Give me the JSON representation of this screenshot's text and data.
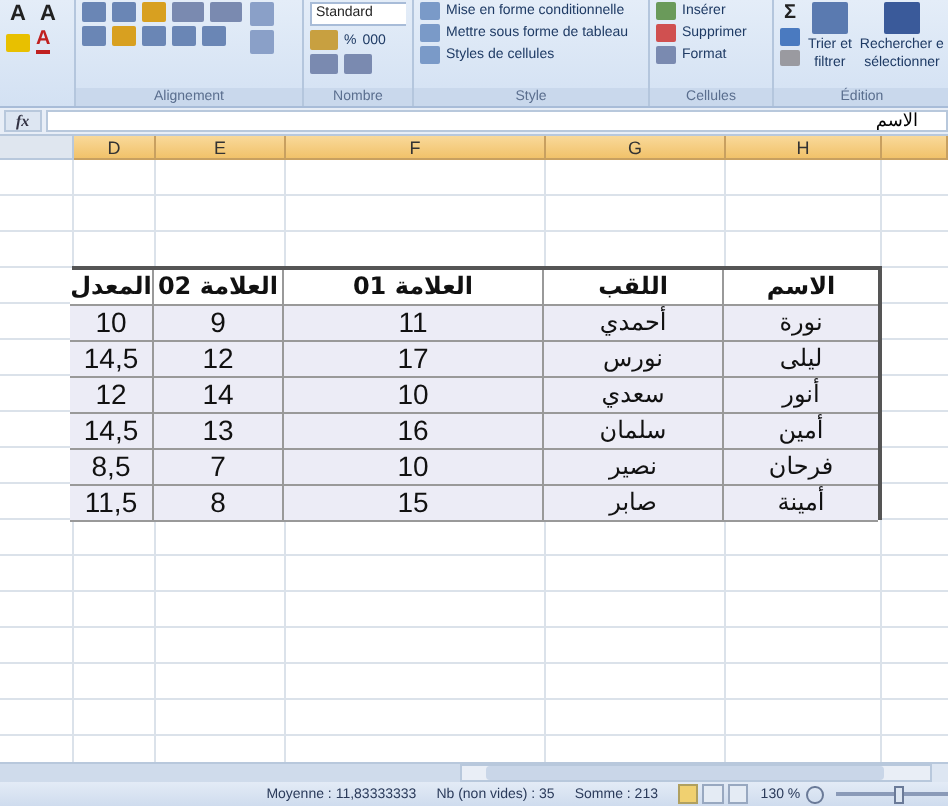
{
  "ribbon": {
    "font": {
      "grow": "A",
      "shrink": "A",
      "font_color_label": "A"
    },
    "alignment": {
      "label": "Alignement"
    },
    "number": {
      "label": "Nombre",
      "format": "Standard",
      "percent": "%",
      "thousands": "000"
    },
    "style": {
      "label": "Style",
      "items": [
        "Mise en forme conditionnelle",
        "Mettre sous forme de tableau",
        "Styles de cellules"
      ]
    },
    "cells": {
      "label": "Cellules",
      "items": [
        "Insérer",
        "Supprimer",
        "Format"
      ]
    },
    "editing": {
      "label": "Édition",
      "sum": "Σ",
      "sort_filter": [
        "Trier et",
        "filtrer"
      ],
      "find_select": [
        "Rechercher e",
        "sélectionner"
      ]
    }
  },
  "formula_bar": {
    "function_label": "fx",
    "value": "الاسم"
  },
  "sheet": {
    "column_headers": {
      "d": "D",
      "e": "E",
      "f": "F",
      "g": "G",
      "h": "H"
    },
    "table": {
      "header": [
        "الاسم",
        "اللقب",
        "العلامة 01",
        "العلامة 02",
        "المعدل"
      ],
      "rows": [
        [
          "نورة",
          "أحمدي",
          "11",
          "9",
          "10"
        ],
        [
          "ليلى",
          "نورس",
          "17",
          "12",
          "14,5"
        ],
        [
          "أنور",
          "سعدي",
          "10",
          "14",
          "12"
        ],
        [
          "أمين",
          "سلمان",
          "16",
          "13",
          "14,5"
        ],
        [
          "فرحان",
          "نصير",
          "10",
          "7",
          "8,5"
        ],
        [
          "أمينة",
          "صابر",
          "15",
          "8",
          "11,5"
        ]
      ]
    }
  },
  "status_bar": {
    "average": "Moyenne : 11,83333333",
    "count": "Nb (non vides) : 35",
    "sum": "Somme : 213",
    "zoom": "130 %",
    "zoom_slider": {
      "level": 0.55
    }
  }
}
